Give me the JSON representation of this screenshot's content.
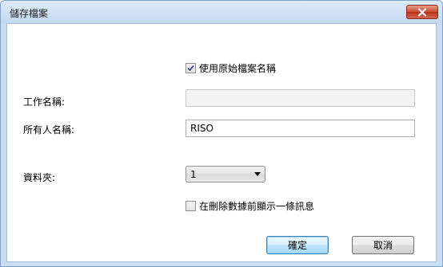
{
  "window": {
    "title": "儲存檔案"
  },
  "use_original_filename": {
    "label": "使用原始檔案名稱",
    "checked": true
  },
  "job_name": {
    "label": "工作名稱:",
    "value": "",
    "disabled": true
  },
  "owner_name": {
    "label": "所有人名稱:",
    "value": "RISO"
  },
  "folder": {
    "label": "資料夾:",
    "selected": "1"
  },
  "show_message_before_delete": {
    "label": "在刪除數據前顯示一條訊息",
    "checked": false
  },
  "buttons": {
    "ok": "確定",
    "cancel": "取消"
  },
  "icons": {
    "close": "close-icon",
    "check": "checkmark-icon",
    "dropdown": "chevron-down-icon"
  }
}
